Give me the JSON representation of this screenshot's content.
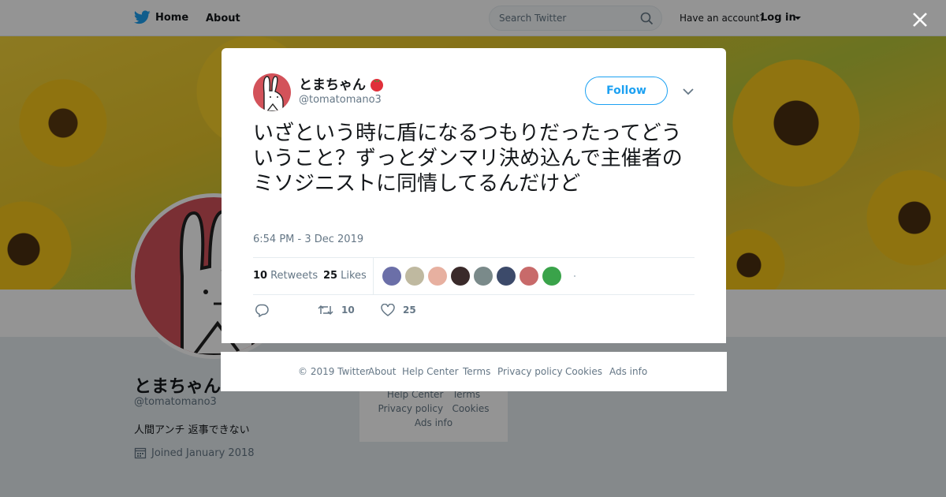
{
  "topbar": {
    "home_label": "Home",
    "about_label": "About",
    "search_placeholder": "Search Twitter",
    "have_account": "Have an account?",
    "login_label": "Log in"
  },
  "profile": {
    "name": "とまちゃん",
    "handle": "@tomatomano3",
    "bio": "人間アンチ 返事できない",
    "joined": "Joined January 2018",
    "links": {
      "help_center": "Help Center",
      "terms": "Terms",
      "privacy": "Privacy policy",
      "cookies": "Cookies",
      "ads_info": "Ads info"
    }
  },
  "tweet": {
    "author_name": "とまちゃん",
    "author_handle": "@tomatomano3",
    "follow_label": "Follow",
    "text": "いざという時に盾になるつもりだったってどういうこと？ずっとダンマリ決め込んで主催者のミソジニストに同情してるんだけど",
    "timestamp": "6:54 PM - 3 Dec 2019",
    "retweet_count": "10",
    "retweet_label": "Retweets",
    "like_count": "25",
    "like_label": "Likes",
    "action_retweet_count": "10",
    "action_like_count": "25",
    "liker_colors": [
      "#6b6fa8",
      "#bfb9a0",
      "#e7b0a0",
      "#3a2a2a",
      "#7a8a8a",
      "#3c4a6a",
      "#c86a6a",
      "#3aa34a"
    ]
  },
  "footer": {
    "copyright": "© 2019 Twitter",
    "about": "About",
    "help_center": "Help Center",
    "terms": "Terms",
    "privacy": "Privacy policy",
    "cookies": "Cookies",
    "ads_info": "Ads info"
  },
  "colors": {
    "brand": "#1da1f2",
    "text_primary": "#14171a",
    "text_secondary": "#657786",
    "avatar_bg": "#d3525a"
  },
  "icons": {
    "brand": "twitter-bird-icon",
    "search": "search-icon",
    "close": "close-icon",
    "reply": "reply-icon",
    "retweet": "retweet-icon",
    "like": "heart-icon",
    "more": "chevron-down-icon",
    "calendar": "calendar-icon"
  }
}
